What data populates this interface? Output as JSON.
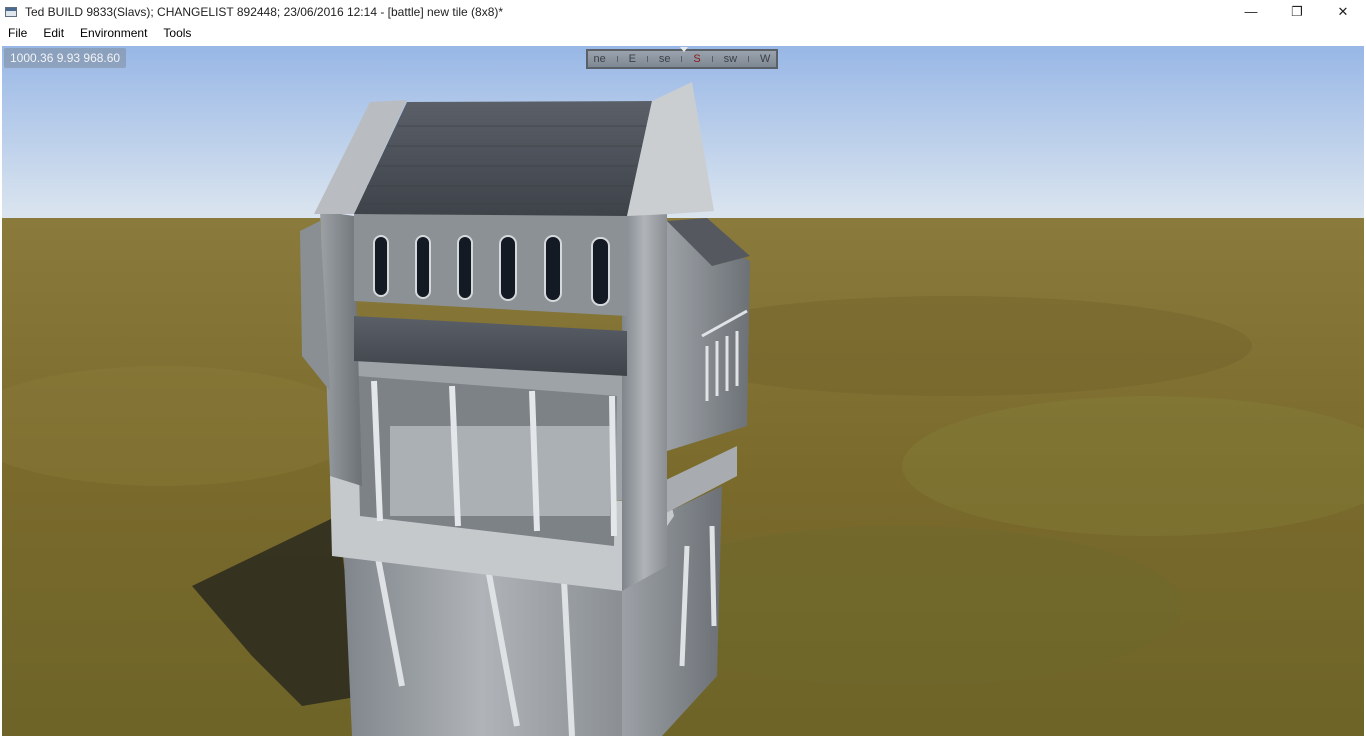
{
  "window": {
    "title": "Ted BUILD 9833(Slavs); CHANGELIST 892448; 23/06/2016 12:14 - [battle] new tile (8x8)*",
    "controls": {
      "minimize": "—",
      "restore": "❐",
      "close": "✕"
    }
  },
  "menu": {
    "items": [
      "File",
      "Edit",
      "Environment",
      "Tools"
    ]
  },
  "viewport": {
    "coordinates": "1000.36 9.93 968.60",
    "compass": {
      "labels": [
        "ne",
        "E",
        "se",
        "S",
        "sw",
        "W"
      ],
      "active": "S",
      "active_color": "#8b1a1a"
    },
    "scene": {
      "sky_top": "#9fbde9",
      "sky_horizon": "#d9e4ef",
      "ground": "#7c6b2f",
      "stone": "#9a9ea3",
      "roof": "#4f545b"
    }
  }
}
